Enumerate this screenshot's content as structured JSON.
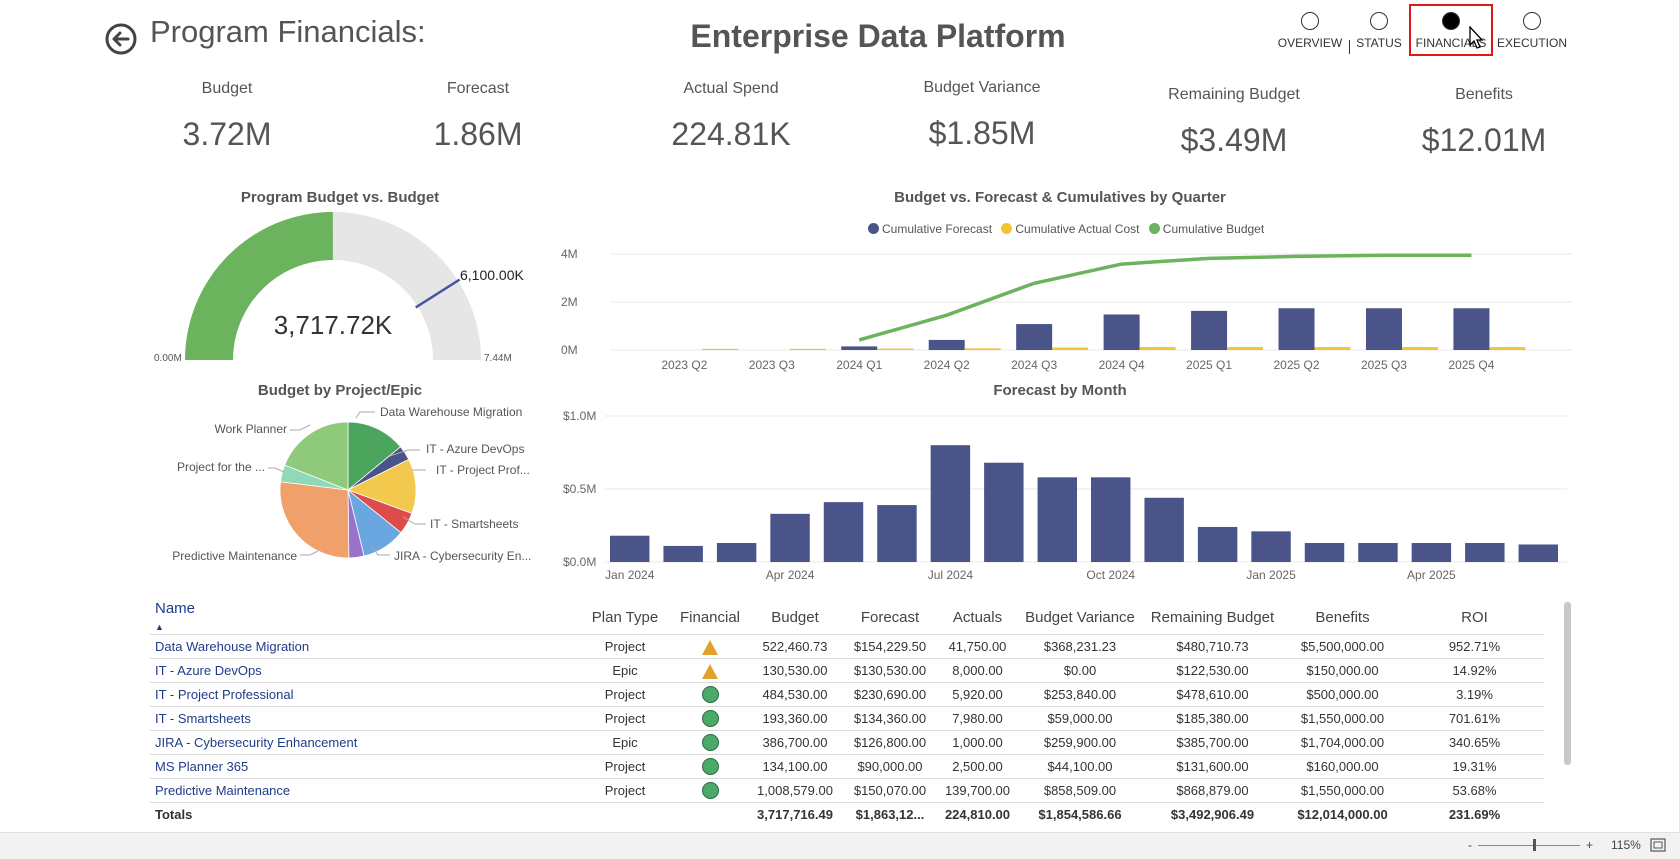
{
  "header": {
    "page_title": "Program Financials:",
    "report_title": "Enterprise Data Platform",
    "back_icon": "back-arrow-icon"
  },
  "nav": [
    {
      "label": "OVERVIEW",
      "selected": false
    },
    {
      "label": "STATUS",
      "selected": false
    },
    {
      "label": "FINANCIALS",
      "selected": true
    },
    {
      "label": "EXECUTION",
      "selected": false
    }
  ],
  "kpis": [
    {
      "label": "Budget",
      "value": "3.72M"
    },
    {
      "label": "Forecast",
      "value": "1.86M"
    },
    {
      "label": "Actual Spend",
      "value": "224.81K"
    },
    {
      "label": "Budget Variance",
      "value": "$1.85M"
    },
    {
      "label": "Remaining Budget",
      "value": "$3.49M"
    },
    {
      "label": "Benefits",
      "value": "$12.01M"
    }
  ],
  "gauge": {
    "title": "Program Budget vs. Budget",
    "value_label": "3,717.72K",
    "target_label": "6,100.00K",
    "min_label": "0.00M",
    "max_label": "7.44M",
    "value": 3717.72,
    "target": 6100,
    "min": 0,
    "max": 7440,
    "fill_color": "#6bb35d",
    "track_color": "#e6e6e6",
    "target_color": "#4a55a2"
  },
  "pie": {
    "title": "Budget by Project/Epic",
    "labels": {
      "data_warehouse": "Data Warehouse Migration",
      "azure": "IT - Azure DevOps",
      "project_prof": "IT - Project Prof...",
      "smartsheets": "IT - Smartsheets",
      "jira": "JIRA - Cybersecurity En...",
      "predictive": "Predictive Maintenance",
      "project_for": "Project for the ...",
      "work_planner": "Work Planner"
    }
  },
  "combo_chart": {
    "title": "Budget vs. Forecast & Cumulatives by Quarter",
    "legend": [
      {
        "name": "Cumulative Forecast",
        "color": "#4a5488"
      },
      {
        "name": "Cumulative Actual Cost",
        "color": "#f2c431"
      },
      {
        "name": "Cumulative Budget",
        "color": "#6bb35d"
      }
    ],
    "y_ticks": [
      "4M",
      "2M",
      "0M"
    ]
  },
  "month_chart": {
    "title": "Forecast by Month",
    "y_ticks": [
      "$1.0M",
      "$0.5M",
      "$0.0M"
    ],
    "x_ticks": [
      "Jan 2024",
      "Apr 2024",
      "Jul 2024",
      "Oct 2024",
      "Jan 2025",
      "Apr 2025"
    ]
  },
  "chart_data": [
    {
      "type": "pie",
      "title": "Budget by Project/Epic",
      "categories": [
        "Data Warehouse Migration",
        "IT - Azure DevOps",
        "IT - Project Prof...",
        "IT - Smartsheets",
        "JIRA - Cybersecurity En...",
        "MS Planner 365",
        "Predictive Maintenance",
        "Project for the ...",
        "Work Planner"
      ],
      "values": [
        522460.73,
        130530,
        484530,
        193360,
        386700,
        134100,
        1008579,
        150000,
        707457
      ],
      "colors": [
        "#4ca55d",
        "#4a5488",
        "#f2c94c",
        "#dd4b4b",
        "#6aa6e0",
        "#9a72c9",
        "#f0a06a",
        "#8fd8b8",
        "#8fc97a"
      ]
    },
    {
      "type": "bar",
      "title": "Budget vs. Forecast & Cumulatives by Quarter",
      "categories": [
        "2023 Q2",
        "2023 Q3",
        "2024 Q1",
        "2024 Q2",
        "2024 Q3",
        "2024 Q4",
        "2025 Q1",
        "2025 Q2",
        "2025 Q3",
        "2025 Q4"
      ],
      "series": [
        {
          "name": "Cumulative Forecast",
          "values": [
            0,
            0,
            0.15,
            0.42,
            1.08,
            1.48,
            1.63,
            1.74,
            1.74,
            1.74
          ]
        },
        {
          "name": "Cumulative Actual Cost",
          "values": [
            0.05,
            0.05,
            0.06,
            0.07,
            0.1,
            0.12,
            0.12,
            0.12,
            0.12,
            0.12
          ]
        },
        {
          "name": "Cumulative Budget",
          "values": [
            null,
            null,
            0.42,
            1.45,
            2.78,
            3.58,
            3.82,
            3.9,
            3.95,
            3.95
          ]
        }
      ],
      "ylabel": "",
      "ylim": [
        0,
        4.4
      ]
    },
    {
      "type": "bar",
      "title": "Forecast by Month",
      "categories": [
        "Jan 2024",
        "Feb 2024",
        "Mar 2024",
        "Apr 2024",
        "May 2024",
        "Jun 2024",
        "Jul 2024",
        "Aug 2024",
        "Sep 2024",
        "Oct 2024",
        "Nov 2024",
        "Dec 2024",
        "Jan 2025",
        "Feb 2025",
        "Mar 2025",
        "Apr 2025",
        "May 2025",
        "Jun 2025"
      ],
      "values": [
        0.18,
        0.11,
        0.13,
        0.33,
        0.41,
        0.39,
        0.8,
        0.68,
        0.58,
        0.58,
        0.44,
        0.24,
        0.21,
        0.13,
        0.13,
        0.13,
        0.13,
        0.12
      ],
      "ylim": [
        0,
        1.0
      ]
    }
  ],
  "table": {
    "columns": [
      "Name",
      "Plan Type",
      "Financial",
      "Budget",
      "Forecast",
      "Actuals",
      "Budget Variance",
      "Remaining Budget",
      "Benefits",
      "ROI"
    ],
    "rows": [
      {
        "name": "Data Warehouse Migration",
        "plan": "Project",
        "fin": "warning-triangle-icon",
        "budget": "522,460.73",
        "forecast": "$154,229.50",
        "actuals": "41,750.00",
        "variance": "$368,231.23",
        "remaining": "$480,710.73",
        "benefits": "$5,500,000.00",
        "roi": "952.71%"
      },
      {
        "name": "IT - Azure DevOps",
        "plan": "Epic",
        "fin": "warning-triangle-icon",
        "budget": "130,530.00",
        "forecast": "$130,530.00",
        "actuals": "8,000.00",
        "variance": "$0.00",
        "remaining": "$122,530.00",
        "benefits": "$150,000.00",
        "roi": "14.92%"
      },
      {
        "name": "IT - Project Professional",
        "plan": "Project",
        "fin": "green-circle-icon",
        "budget": "484,530.00",
        "forecast": "$230,690.00",
        "actuals": "5,920.00",
        "variance": "$253,840.00",
        "remaining": "$478,610.00",
        "benefits": "$500,000.00",
        "roi": "3.19%"
      },
      {
        "name": "IT - Smartsheets",
        "plan": "Project",
        "fin": "green-circle-icon",
        "budget": "193,360.00",
        "forecast": "$134,360.00",
        "actuals": "7,980.00",
        "variance": "$59,000.00",
        "remaining": "$185,380.00",
        "benefits": "$1,550,000.00",
        "roi": "701.61%"
      },
      {
        "name": "JIRA - Cybersecurity Enhancement",
        "plan": "Epic",
        "fin": "green-circle-icon",
        "budget": "386,700.00",
        "forecast": "$126,800.00",
        "actuals": "1,000.00",
        "variance": "$259,900.00",
        "remaining": "$385,700.00",
        "benefits": "$1,704,000.00",
        "roi": "340.65%"
      },
      {
        "name": "MS Planner 365",
        "plan": "Project",
        "fin": "green-circle-icon",
        "budget": "134,100.00",
        "forecast": "$90,000.00",
        "actuals": "2,500.00",
        "variance": "$44,100.00",
        "remaining": "$131,600.00",
        "benefits": "$160,000.00",
        "roi": "19.31%"
      },
      {
        "name": "Predictive Maintenance",
        "plan": "Project",
        "fin": "green-circle-icon",
        "budget": "1,008,579.00",
        "forecast": "$150,070.00",
        "actuals": "139,700.00",
        "variance": "$858,509.00",
        "remaining": "$868,879.00",
        "benefits": "$1,550,000.00",
        "roi": "53.68%"
      }
    ],
    "totals": {
      "name": "Totals",
      "budget": "3,717,716.49",
      "forecast": "$1,863,12...",
      "actuals": "224,810.00",
      "variance": "$1,854,586.66",
      "remaining": "$3,492,906.49",
      "benefits": "$12,014,000.00",
      "roi": "231.69%"
    }
  },
  "statusbar": {
    "zoom_minus": "-",
    "zoom_plus": "+",
    "zoom_level": "115%",
    "zoom_percent": 0.55
  }
}
